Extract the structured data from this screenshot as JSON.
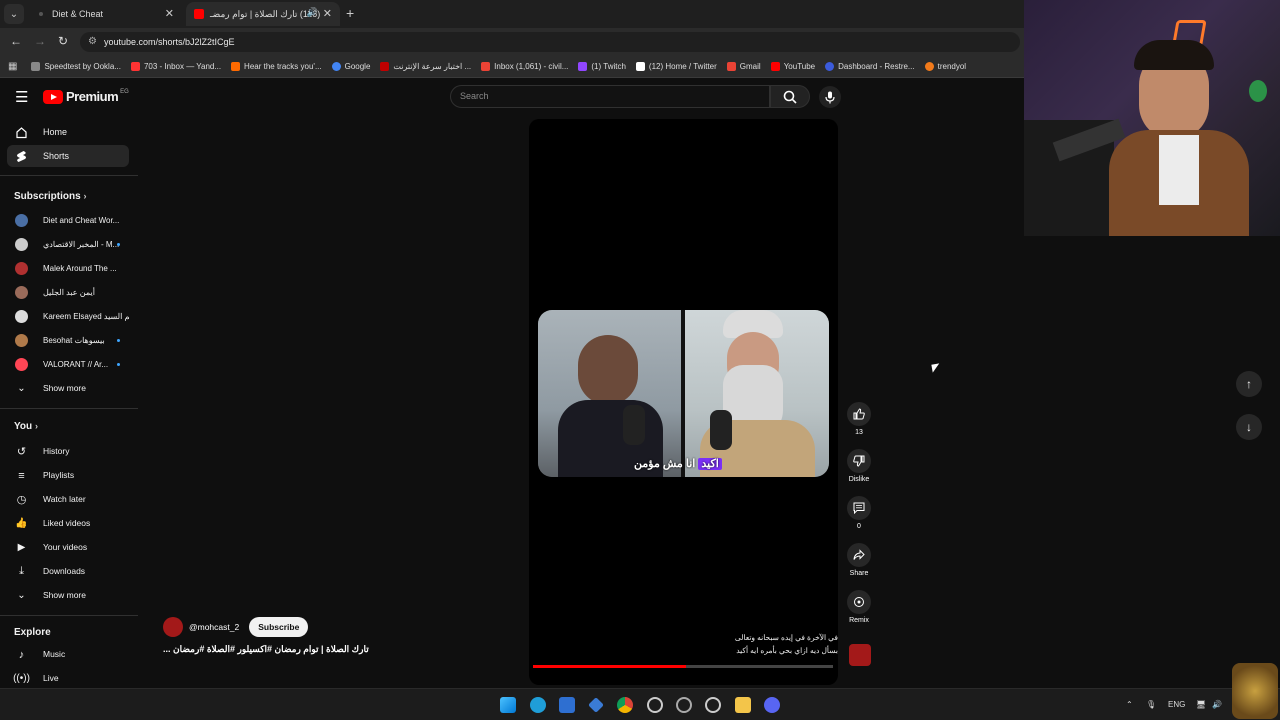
{
  "browser": {
    "tabs": [
      {
        "label": "Diet & Cheat",
        "active": false
      },
      {
        "label": "(116) تارك الصلاة | توام رمضـ",
        "active": true
      }
    ],
    "url": "youtube.com/shorts/bJ2lZ2tICgE",
    "bookmarks": [
      {
        "label": "Speedtest by Ookla...",
        "color": "#888888"
      },
      {
        "label": "703 - Inbox — Yand...",
        "color": "#ff3333"
      },
      {
        "label": "Hear the tracks you'...",
        "color": "#ff6a00"
      },
      {
        "label": "Google",
        "color": "#4285f4"
      },
      {
        "label": "اختبار سرعة الإنترنت ...",
        "color": "#c00000"
      },
      {
        "label": "Inbox (1,061) - civil...",
        "color": "#ea4335"
      },
      {
        "label": "(1) Twitch",
        "color": "#9146ff"
      },
      {
        "label": "(12) Home / Twitter",
        "color": "#ffffff"
      },
      {
        "label": "Gmail",
        "color": "#ea4335"
      },
      {
        "label": "YouTube",
        "color": "#ff0000"
      },
      {
        "label": "Dashboard - Restre...",
        "color": "#3b5bdb"
      },
      {
        "label": "trendyol",
        "color": "#f27a1a"
      }
    ]
  },
  "youtube": {
    "logo_text": "Premium",
    "country_code": "EG",
    "search_placeholder": "Search",
    "nav": [
      {
        "label": "Home",
        "icon": "home-icon"
      },
      {
        "label": "Shorts",
        "icon": "shorts-icon"
      }
    ],
    "subscriptions_title": "Subscriptions",
    "subscriptions": [
      {
        "label": "Diet and Cheat Wor...",
        "color": "#4a6fa5",
        "dot": false
      },
      {
        "label": "المخبر الاقتصادي - M...",
        "color": "#cccccc",
        "dot": true
      },
      {
        "label": "Malek Around The ...",
        "color": "#b03030",
        "dot": false
      },
      {
        "label": "أيمن عبد الجليل",
        "color": "#9a6b5a",
        "dot": false
      },
      {
        "label": "Kareem Elsayed كريم السيد",
        "color": "#dddddd",
        "dot": false
      },
      {
        "label": "Besohat بيسوهات",
        "color": "#b07a4a",
        "dot": true
      },
      {
        "label": "VALORANT // Ar...",
        "color": "#ff4655",
        "dot": true
      }
    ],
    "show_more_1": "Show more",
    "you_title": "You",
    "you_items": [
      {
        "label": "History",
        "icon": "history-icon"
      },
      {
        "label": "Playlists",
        "icon": "playlists-icon"
      },
      {
        "label": "Watch later",
        "icon": "watch-later-icon"
      },
      {
        "label": "Liked videos",
        "icon": "liked-videos-icon"
      },
      {
        "label": "Your videos",
        "icon": "your-videos-icon"
      },
      {
        "label": "Downloads",
        "icon": "downloads-icon"
      }
    ],
    "show_more_2": "Show more",
    "explore_title": "Explore",
    "explore_items": [
      {
        "label": "Music",
        "icon": "music-icon"
      },
      {
        "label": "Live",
        "icon": "live-icon"
      }
    ]
  },
  "short": {
    "caption_highlight": "اكيد",
    "caption_rest": "انا مش مؤمن",
    "subtitle_line1": "في الآخرة في إيده سبحانه وتعالى",
    "subtitle_line2": "بسأل ديه ازاي بحي بأمره ايه أكيد",
    "progress": 0.51,
    "channel": "@mohcast_2",
    "subscribe_label": "Subscribe",
    "title": "تارك الصلاة | توام رمضان #اكسيلور #الصلاة #رمضان ..."
  },
  "actions": {
    "like_count": "13",
    "dislike_label": "Dislike",
    "comments_count": "0",
    "share_label": "Share",
    "remix_label": "Remix"
  },
  "taskbar": {
    "lang": "ENG"
  }
}
